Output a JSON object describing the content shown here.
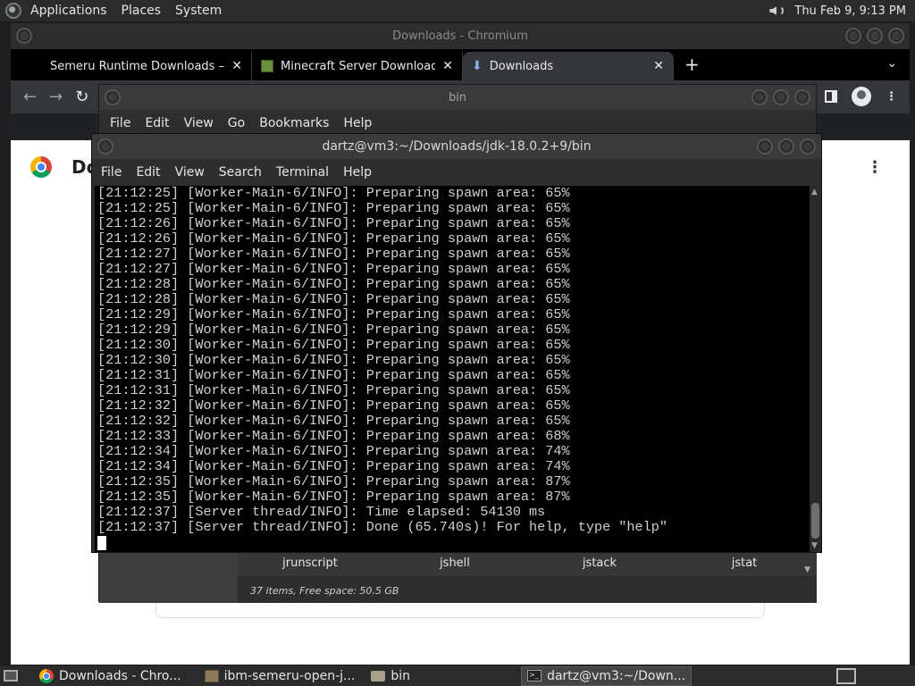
{
  "top_panel": {
    "menus": [
      "Applications",
      "Places",
      "System"
    ],
    "clock": "Thu Feb  9,  9:13 PM"
  },
  "chromium": {
    "window_title": "Downloads - Chromium",
    "tabs": [
      {
        "label": "Semeru Runtime Downloads –",
        "close": "✕"
      },
      {
        "label": "Minecraft Server Download | M",
        "close": "✕"
      },
      {
        "label": "Downloads",
        "close": "✕"
      }
    ],
    "new_tab": "+",
    "page_heading": "Do"
  },
  "file_manager": {
    "window_title": "bin",
    "menus": [
      "File",
      "Edit",
      "View",
      "Go",
      "Bookmarks",
      "Help"
    ],
    "files": [
      "jrunscript",
      "jshell",
      "jstack",
      "jstat"
    ],
    "status": "37 items, Free space: 50.5 GB"
  },
  "terminal": {
    "window_title": "dartz@vm3:~/Downloads/jdk-18.0.2+9/bin",
    "menus": [
      "File",
      "Edit",
      "View",
      "Search",
      "Terminal",
      "Help"
    ],
    "lines": [
      "[21:12:25] [Worker-Main-6/INFO]: Preparing spawn area: 65%",
      "[21:12:25] [Worker-Main-6/INFO]: Preparing spawn area: 65%",
      "[21:12:26] [Worker-Main-6/INFO]: Preparing spawn area: 65%",
      "[21:12:26] [Worker-Main-6/INFO]: Preparing spawn area: 65%",
      "[21:12:27] [Worker-Main-6/INFO]: Preparing spawn area: 65%",
      "[21:12:27] [Worker-Main-6/INFO]: Preparing spawn area: 65%",
      "[21:12:28] [Worker-Main-6/INFO]: Preparing spawn area: 65%",
      "[21:12:28] [Worker-Main-6/INFO]: Preparing spawn area: 65%",
      "[21:12:29] [Worker-Main-6/INFO]: Preparing spawn area: 65%",
      "[21:12:29] [Worker-Main-6/INFO]: Preparing spawn area: 65%",
      "[21:12:30] [Worker-Main-6/INFO]: Preparing spawn area: 65%",
      "[21:12:30] [Worker-Main-6/INFO]: Preparing spawn area: 65%",
      "[21:12:31] [Worker-Main-6/INFO]: Preparing spawn area: 65%",
      "[21:12:31] [Worker-Main-6/INFO]: Preparing spawn area: 65%",
      "[21:12:32] [Worker-Main-6/INFO]: Preparing spawn area: 65%",
      "[21:12:32] [Worker-Main-6/INFO]: Preparing spawn area: 65%",
      "[21:12:33] [Worker-Main-6/INFO]: Preparing spawn area: 68%",
      "[21:12:34] [Worker-Main-6/INFO]: Preparing spawn area: 74%",
      "[21:12:34] [Worker-Main-6/INFO]: Preparing spawn area: 74%",
      "[21:12:35] [Worker-Main-6/INFO]: Preparing spawn area: 87%",
      "[21:12:35] [Worker-Main-6/INFO]: Preparing spawn area: 87%",
      "[21:12:37] [Server thread/INFO]: Time elapsed: 54130 ms",
      "[21:12:37] [Server thread/INFO]: Done (65.740s)! For help, type \"help\""
    ]
  },
  "taskbar": {
    "items": [
      {
        "label": "Downloads - Chro...",
        "icon": "chrome-icon"
      },
      {
        "label": "ibm-semeru-open-j...",
        "icon": "archive-icon"
      },
      {
        "label": "bin",
        "icon": "folder-icon"
      },
      {
        "label": "dartz@vm3:~/Down...",
        "icon": "terminal-icon"
      }
    ]
  }
}
